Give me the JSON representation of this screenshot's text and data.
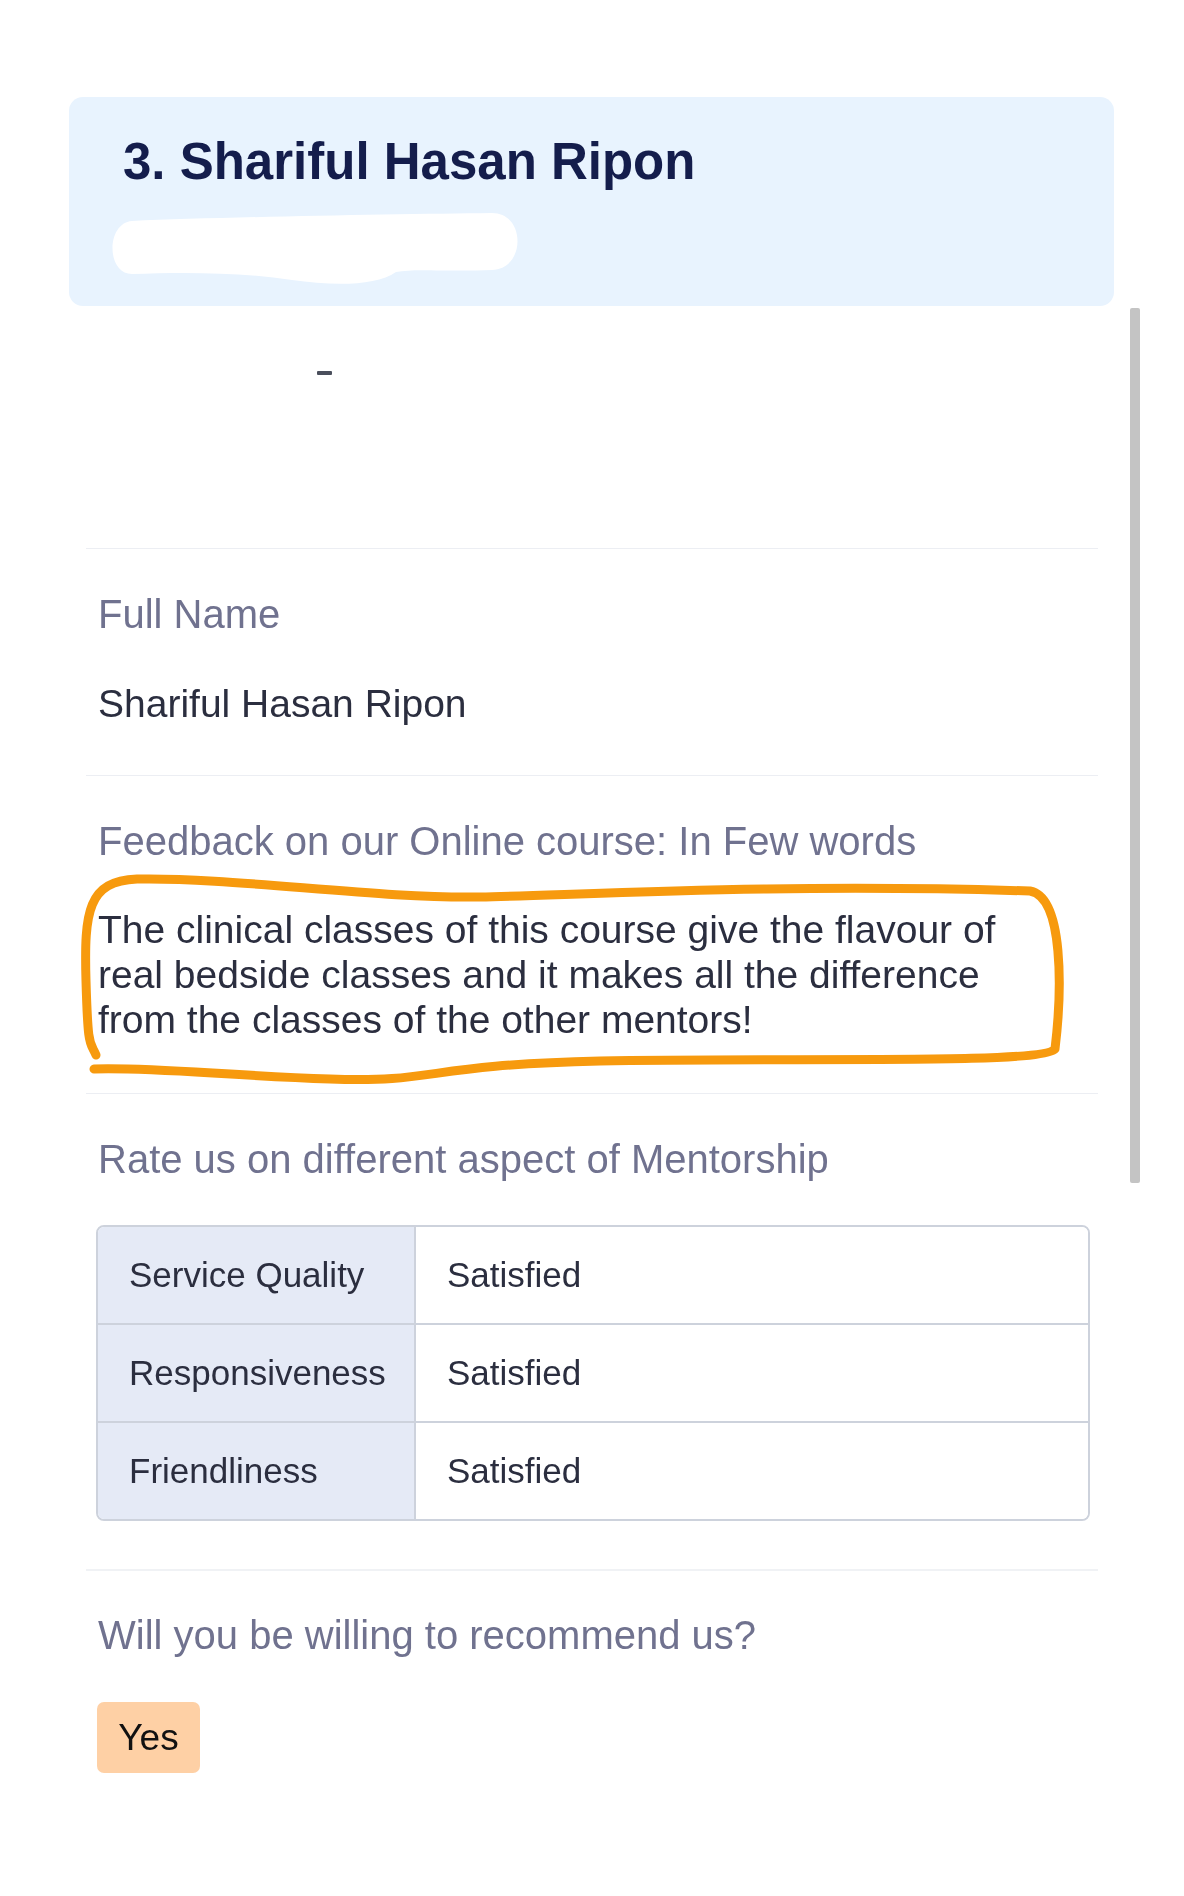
{
  "header": {
    "title": "3. Shariful Hasan Ripon",
    "redacted": true
  },
  "fields": [
    {
      "kind": "text",
      "label": "Full Name",
      "value": "Shariful Hasan Ripon",
      "circled": false
    },
    {
      "kind": "text",
      "label": "Feedback on our Online course: In Few words",
      "value": "The clinical classes of this course give the flavour of real bedside classes and it makes all the difference from the classes of the other mentors!",
      "circled": true
    },
    {
      "kind": "table",
      "label": "Rate us on different aspect of Mentorship",
      "rows": [
        {
          "aspect": "Service Quality",
          "rating": "Satisfied"
        },
        {
          "aspect": "Responsiveness",
          "rating": "Satisfied"
        },
        {
          "aspect": "Friendliness",
          "rating": "Satisfied"
        }
      ],
      "circled": false
    },
    {
      "kind": "choice",
      "label": "Will you be willing to recommend us?",
      "answer": "Yes",
      "circled": false
    }
  ]
}
